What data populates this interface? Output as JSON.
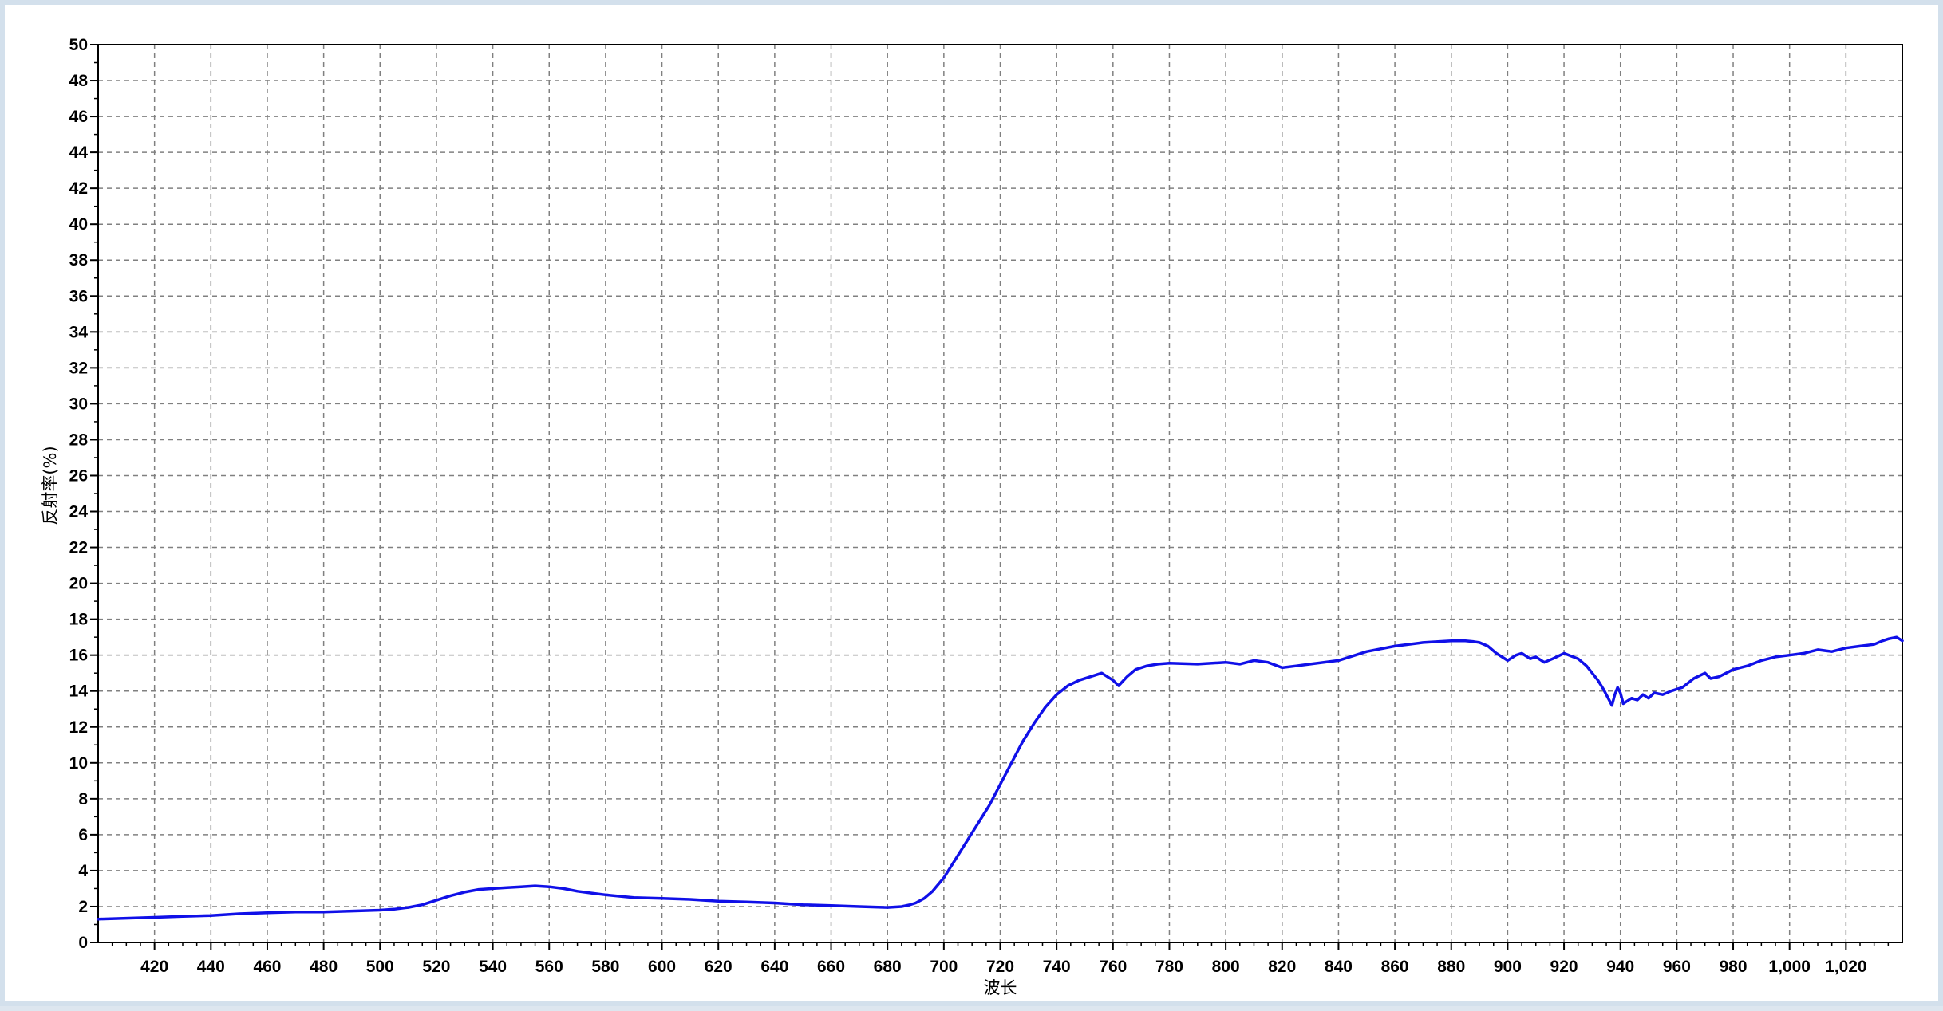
{
  "chart_data": {
    "type": "line",
    "title": "",
    "xlabel": "波长",
    "ylabel": "反射率(%)",
    "xlim": [
      400,
      1040
    ],
    "ylim": [
      0,
      50
    ],
    "grid": true,
    "legend": "none",
    "line_color": "#1010e8",
    "x_ticks": [
      "420",
      "440",
      "460",
      "480",
      "500",
      "520",
      "540",
      "560",
      "580",
      "600",
      "620",
      "640",
      "660",
      "680",
      "700",
      "720",
      "740",
      "760",
      "780",
      "800",
      "820",
      "840",
      "860",
      "880",
      "900",
      "920",
      "940",
      "960",
      "980",
      "1,000",
      "1,020"
    ],
    "y_ticks": [
      "0",
      "2",
      "4",
      "6",
      "8",
      "10",
      "12",
      "14",
      "16",
      "18",
      "20",
      "22",
      "24",
      "26",
      "28",
      "30",
      "32",
      "34",
      "36",
      "38",
      "40",
      "42",
      "44",
      "46",
      "48",
      "50"
    ],
    "series": [
      {
        "x": [
          400,
          410,
          420,
          430,
          440,
          450,
          460,
          470,
          480,
          490,
          500,
          505,
          510,
          515,
          520,
          525,
          530,
          535,
          540,
          545,
          550,
          555,
          560,
          565,
          570,
          575,
          580,
          590,
          600,
          610,
          620,
          630,
          640,
          650,
          660,
          670,
          680,
          685,
          688,
          690,
          693,
          696,
          700,
          704,
          708,
          712,
          716,
          720,
          724,
          728,
          732,
          736,
          740,
          744,
          748,
          752,
          756,
          760,
          762,
          765,
          768,
          772,
          776,
          780,
          790,
          800,
          805,
          810,
          815,
          820,
          825,
          830,
          840,
          850,
          860,
          870,
          880,
          885,
          888,
          890,
          893,
          896,
          900,
          903,
          905,
          908,
          910,
          913,
          916,
          920,
          925,
          928,
          930,
          932,
          934,
          936,
          937,
          938,
          939,
          940,
          941,
          942,
          944,
          946,
          948,
          950,
          952,
          955,
          958,
          962,
          966,
          970,
          972,
          975,
          980,
          985,
          990,
          995,
          1000,
          1005,
          1010,
          1015,
          1020,
          1025,
          1030,
          1033,
          1035,
          1038,
          1040
        ],
        "y": [
          1.3,
          1.35,
          1.4,
          1.45,
          1.5,
          1.6,
          1.65,
          1.7,
          1.7,
          1.75,
          1.8,
          1.85,
          1.95,
          2.1,
          2.35,
          2.6,
          2.8,
          2.95,
          3.0,
          3.05,
          3.1,
          3.15,
          3.1,
          3.0,
          2.85,
          2.75,
          2.65,
          2.5,
          2.45,
          2.4,
          2.3,
          2.25,
          2.2,
          2.1,
          2.05,
          2.0,
          1.95,
          2.0,
          2.1,
          2.2,
          2.45,
          2.85,
          3.6,
          4.6,
          5.6,
          6.6,
          7.6,
          8.8,
          10.0,
          11.2,
          12.2,
          13.1,
          13.8,
          14.3,
          14.6,
          14.8,
          15.0,
          14.6,
          14.3,
          14.8,
          15.2,
          15.4,
          15.5,
          15.55,
          15.5,
          15.6,
          15.5,
          15.7,
          15.6,
          15.3,
          15.4,
          15.5,
          15.7,
          16.2,
          16.5,
          16.7,
          16.8,
          16.8,
          16.75,
          16.7,
          16.5,
          16.1,
          15.7,
          16.0,
          16.1,
          15.8,
          15.9,
          15.6,
          15.8,
          16.1,
          15.8,
          15.4,
          15.0,
          14.6,
          14.1,
          13.5,
          13.2,
          13.8,
          14.2,
          13.9,
          13.3,
          13.4,
          13.6,
          13.5,
          13.8,
          13.6,
          13.9,
          13.8,
          14.0,
          14.2,
          14.7,
          15.0,
          14.7,
          14.8,
          15.2,
          15.4,
          15.7,
          15.9,
          16.0,
          16.1,
          16.3,
          16.2,
          16.4,
          16.5,
          16.6,
          16.8,
          16.9,
          17.0,
          16.8
        ]
      }
    ]
  }
}
